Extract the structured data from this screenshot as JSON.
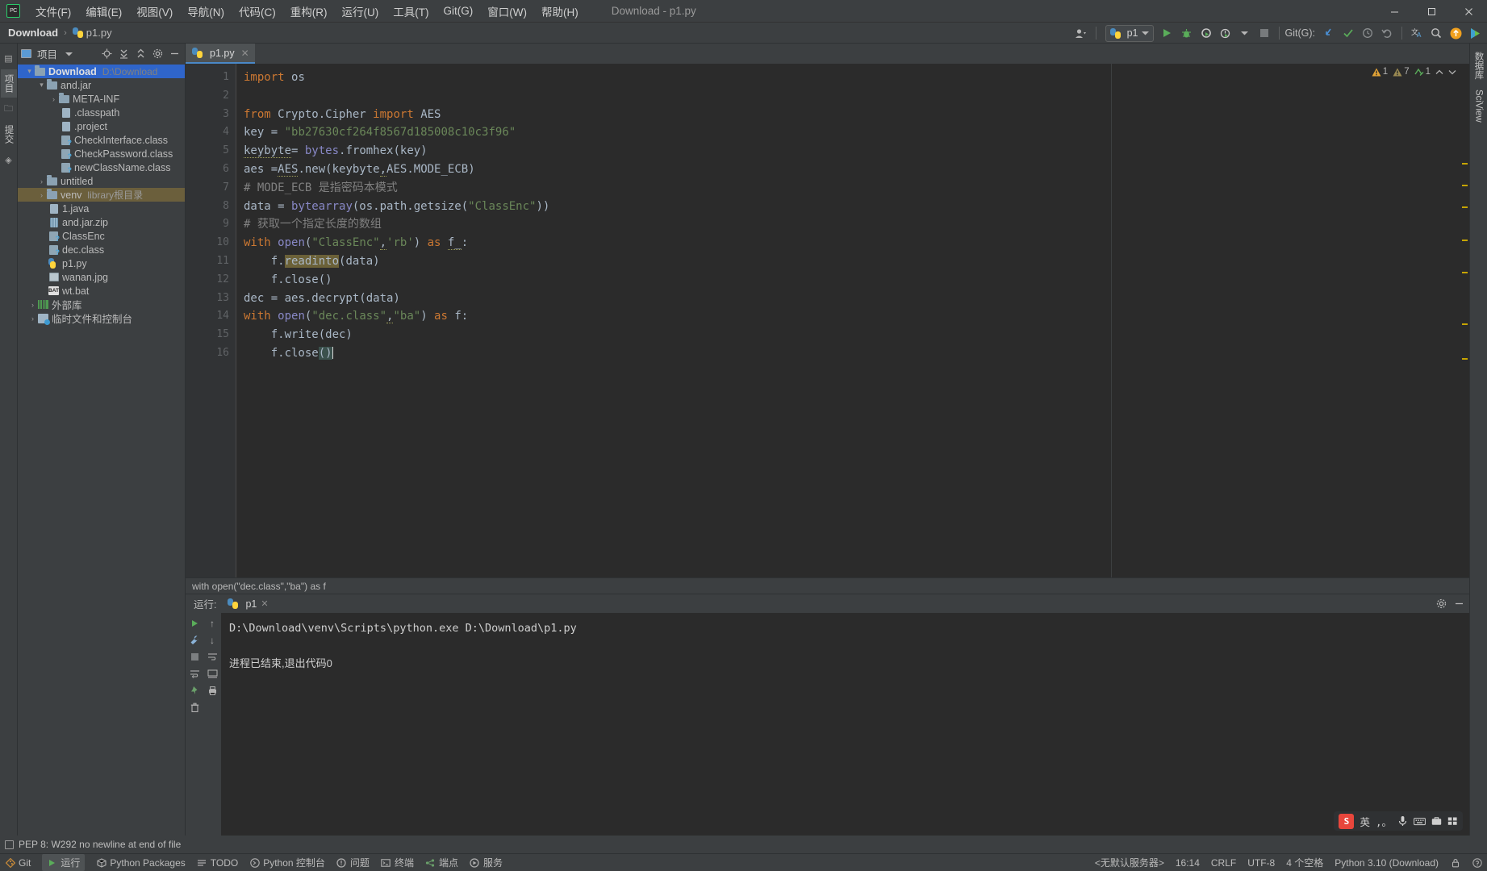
{
  "window": {
    "title": "Download - p1.py",
    "logo": "pycharm-logo",
    "controls": {
      "minimize": "—",
      "maximize": "▢",
      "close": "✕"
    }
  },
  "menubar": {
    "items": [
      {
        "label": "文件(F)",
        "name": "menu-file"
      },
      {
        "label": "编辑(E)",
        "name": "menu-edit"
      },
      {
        "label": "视图(V)",
        "name": "menu-view"
      },
      {
        "label": "导航(N)",
        "name": "menu-navigate"
      },
      {
        "label": "代码(C)",
        "name": "menu-code"
      },
      {
        "label": "重构(R)",
        "name": "menu-refactor"
      },
      {
        "label": "运行(U)",
        "name": "menu-run"
      },
      {
        "label": "工具(T)",
        "name": "menu-tools"
      },
      {
        "label": "Git(G)",
        "name": "menu-git"
      },
      {
        "label": "窗口(W)",
        "name": "menu-window"
      },
      {
        "label": "帮助(H)",
        "name": "menu-help"
      }
    ]
  },
  "navbar": {
    "breadcrumb": {
      "project": "Download",
      "separator": "›",
      "file": "p1.py"
    },
    "run_config": "p1",
    "git_label": "Git(G):",
    "icons": {
      "user": "user-icon",
      "run": "run-icon",
      "debug": "debug-icon",
      "coverage": "coverage-icon",
      "profile": "profile-icon",
      "stop": "stop-icon",
      "update": "update-project-icon",
      "commit": "commit-icon",
      "history": "history-icon",
      "rollback": "rollback-icon",
      "translate": "translate-icon",
      "search": "search-icon",
      "notification": "notification-icon",
      "ide_action": "ide-action-icon"
    }
  },
  "left_rail": {
    "tabs": [
      {
        "label": "项目",
        "name": "rail-project",
        "active": true
      },
      {
        "label": "提交",
        "name": "rail-commit",
        "active": false
      }
    ]
  },
  "right_rail": {
    "tabs": [
      {
        "label": "数据库",
        "name": "rail-database"
      },
      {
        "label": "SciView",
        "name": "rail-sciview"
      }
    ]
  },
  "project_panel": {
    "title": "项目",
    "toolbar": [
      "locate-icon",
      "expand-all-icon",
      "collapse-all-icon",
      "settings-icon",
      "hide-icon"
    ],
    "tree": [
      {
        "label": "Download",
        "sub": "D:\\Download",
        "indent": 0,
        "arrow": "v",
        "icon": "folder",
        "selected": true,
        "bold": true
      },
      {
        "label": "and.jar",
        "sub": "",
        "indent": 1,
        "arrow": "v",
        "icon": "folder"
      },
      {
        "label": "META-INF",
        "sub": "",
        "indent": 2,
        "arrow": ">",
        "icon": "folder"
      },
      {
        "label": ".classpath",
        "sub": "",
        "indent": 3,
        "arrow": "",
        "icon": "doc"
      },
      {
        "label": ".project",
        "sub": "",
        "indent": 3,
        "arrow": "",
        "icon": "doc"
      },
      {
        "label": "CheckInterface.class",
        "sub": "",
        "indent": 3,
        "arrow": "",
        "icon": "class"
      },
      {
        "label": "CheckPassword.class",
        "sub": "",
        "indent": 3,
        "arrow": "",
        "icon": "class"
      },
      {
        "label": "newClassName.class",
        "sub": "",
        "indent": 3,
        "arrow": "",
        "icon": "class"
      },
      {
        "label": "untitled",
        "sub": "",
        "indent": 1,
        "arrow": ">",
        "icon": "folder"
      },
      {
        "label": "venv",
        "sub": "library根目录",
        "indent": 1,
        "arrow": ">",
        "icon": "folder",
        "highlight": true
      },
      {
        "label": "1.java",
        "sub": "",
        "indent": 2,
        "arrow": "",
        "icon": "doc"
      },
      {
        "label": "and.jar.zip",
        "sub": "",
        "indent": 2,
        "arrow": "",
        "icon": "jar"
      },
      {
        "label": "ClassEnc",
        "sub": "",
        "indent": 2,
        "arrow": "",
        "icon": "class"
      },
      {
        "label": "dec.class",
        "sub": "",
        "indent": 2,
        "arrow": "",
        "icon": "class"
      },
      {
        "label": "p1.py",
        "sub": "",
        "indent": 2,
        "arrow": "",
        "icon": "python"
      },
      {
        "label": "wanan.jpg",
        "sub": "",
        "indent": 2,
        "arrow": "",
        "icon": "image"
      },
      {
        "label": "wt.bat",
        "sub": "",
        "indent": 2,
        "arrow": "",
        "icon": "bat"
      },
      {
        "label": "外部库",
        "sub": "",
        "indent": 0,
        "arrow": ">",
        "icon": "lib"
      },
      {
        "label": "临时文件和控制台",
        "sub": "",
        "indent": 0,
        "arrow": ">",
        "icon": "scratch"
      }
    ]
  },
  "editor": {
    "tab": {
      "label": "p1.py",
      "close": "✕"
    },
    "inspection": {
      "warnings": "1",
      "weak_warnings": "7",
      "typos": "1"
    },
    "breadcrumb_bottom": "with open(\"dec.class\",\"ba\") as f",
    "lines": [
      {
        "n": "1",
        "fold": "-",
        "text": "import os"
      },
      {
        "n": "2",
        "fold": "",
        "text": ""
      },
      {
        "n": "3",
        "fold": "-",
        "text": "from Crypto.Cipher import AES"
      },
      {
        "n": "4",
        "fold": "",
        "text": "key = \"bb27630cf264f8567d185008c10c3f96\""
      },
      {
        "n": "5",
        "fold": "",
        "text": "keybyte= bytes.fromhex(key)"
      },
      {
        "n": "6",
        "fold": "",
        "text": "aes =AES.new(keybyte,AES.MODE_ECB)"
      },
      {
        "n": "7",
        "fold": "",
        "text": "# MODE_ECB 是指密码本模式"
      },
      {
        "n": "8",
        "fold": "",
        "text": "data = bytearray(os.path.getsize(\"ClassEnc\"))"
      },
      {
        "n": "9",
        "fold": "",
        "text": "# 获取一个指定长度的数组"
      },
      {
        "n": "10",
        "fold": "-",
        "text": "with open(\"ClassEnc\",'rb') as f_:"
      },
      {
        "n": "11",
        "fold": "",
        "text": "    f.readinto(data)"
      },
      {
        "n": "12",
        "fold": "-",
        "text": "    f.close()"
      },
      {
        "n": "13",
        "fold": "",
        "text": "dec = aes.decrypt(data)"
      },
      {
        "n": "14",
        "fold": "-",
        "text": "with open(\"dec.class\",\"ba\") as f:"
      },
      {
        "n": "15",
        "fold": "",
        "text": "    f.write(dec)"
      },
      {
        "n": "16",
        "fold": "-",
        "text": "    f.close()",
        "bulb": true
      }
    ]
  },
  "run_panel": {
    "label": "运行:",
    "tab": "p1",
    "tab_close": "✕",
    "toolbar_right": [
      "settings-icon",
      "hide-icon"
    ],
    "left_buttons": [
      "rerun-icon",
      "wrench-icon",
      "stop-icon",
      "trash-icon",
      "pin-icon"
    ],
    "gutter_buttons": [
      "up-icon",
      "down-icon",
      "soft-wrap-icon",
      "scroll-end-icon",
      "print-icon"
    ],
    "console": {
      "command": "D:\\Download\\venv\\Scripts\\python.exe D:\\Download\\p1.py",
      "result": "进程已结束,退出代码0"
    },
    "ime": {
      "logo": "S",
      "lang": "英",
      "items": [
        "keyboard-icon",
        "mic-icon",
        "window-icon",
        "box-icon",
        "more-icon"
      ]
    }
  },
  "warning_bar": {
    "text": "PEP 8: W292 no newline at end of file"
  },
  "statusbar": {
    "left": [
      {
        "label": "Git",
        "name": "status-git",
        "icon": "git-icon"
      },
      {
        "label": "运行",
        "name": "status-run",
        "icon": "run-icon",
        "active": true
      },
      {
        "label": "Python Packages",
        "name": "status-python-packages",
        "icon": "package-icon"
      },
      {
        "label": "TODO",
        "name": "status-todo",
        "icon": "todo-icon"
      },
      {
        "label": "Python 控制台",
        "name": "status-python-console",
        "icon": "console-icon"
      },
      {
        "label": "问题",
        "name": "status-problems",
        "icon": "problems-icon"
      },
      {
        "label": "终端",
        "name": "status-terminal",
        "icon": "terminal-icon"
      },
      {
        "label": "端点",
        "name": "status-endpoints",
        "icon": "endpoints-icon"
      },
      {
        "label": "服务",
        "name": "status-services",
        "icon": "services-icon"
      }
    ],
    "right": [
      {
        "label": "<无默认服务器>",
        "name": "status-server"
      },
      {
        "label": "16:14",
        "name": "status-caret-position"
      },
      {
        "label": "CRLF",
        "name": "status-line-separator"
      },
      {
        "label": "UTF-8",
        "name": "status-encoding"
      },
      {
        "label": "4 个空格",
        "name": "status-indent"
      },
      {
        "label": "Python 3.10 (Download)",
        "name": "status-interpreter"
      },
      {
        "label": "lock-icon",
        "name": "status-lock"
      },
      {
        "label": "notification-icon",
        "name": "status-notification"
      }
    ]
  },
  "colors": {
    "bg": "#3c3f41",
    "editor_bg": "#2b2b2b",
    "gutter_bg": "#313335",
    "selection": "#2f65ca",
    "accent_blue": "#4a88c7",
    "keyword": "#cc7832",
    "string": "#6a8759",
    "comment": "#808080",
    "identifier": "#a9b7c6",
    "builtin": "#8888c6"
  }
}
